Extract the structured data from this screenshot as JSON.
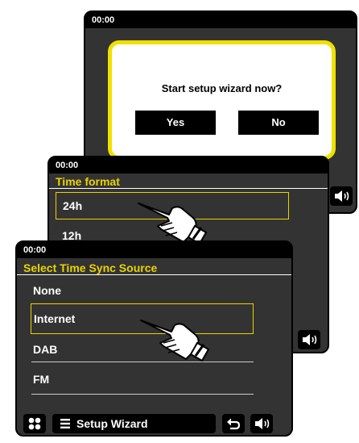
{
  "screen1": {
    "status_time": "00:00",
    "dialog": {
      "question": "Start setup wizard now?",
      "yes_label": "Yes",
      "no_label": "No"
    }
  },
  "screen2": {
    "status_time": "00:00",
    "title": "Time format",
    "items": [
      "24h",
      "12h"
    ],
    "selected_index": 0
  },
  "screen3": {
    "status_time": "00:00",
    "title": "Select Time Sync Source",
    "items": [
      "None",
      "Internet",
      "DAB",
      "FM"
    ],
    "selected_index": 1,
    "bottom_bar": {
      "menu_label": "Setup Wizard"
    }
  },
  "icons": {
    "volume": "volume-icon",
    "grid": "grid-menu-icon",
    "list": "list-icon",
    "back": "back-arrow-icon",
    "pointer": "pointing-hand-icon"
  },
  "colors": {
    "screen_bg": "#333333",
    "title_yellow": "#e8d400",
    "dialog_border": "#f0e000"
  }
}
